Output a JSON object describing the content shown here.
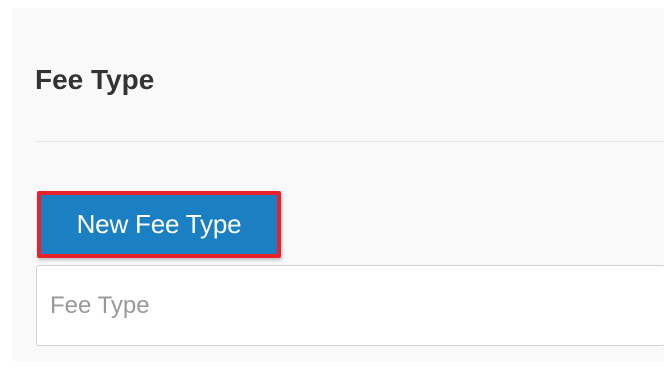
{
  "header": {
    "title": "Fee Type"
  },
  "toolbar": {
    "new_button_label": "New Fee Type"
  },
  "form": {
    "fee_type_field": {
      "value": "",
      "placeholder": "Fee Type"
    }
  },
  "colors": {
    "primary_button": "#1b7fc3",
    "highlight_outline": "#e8212b",
    "panel_background": "#f9f9fa"
  }
}
